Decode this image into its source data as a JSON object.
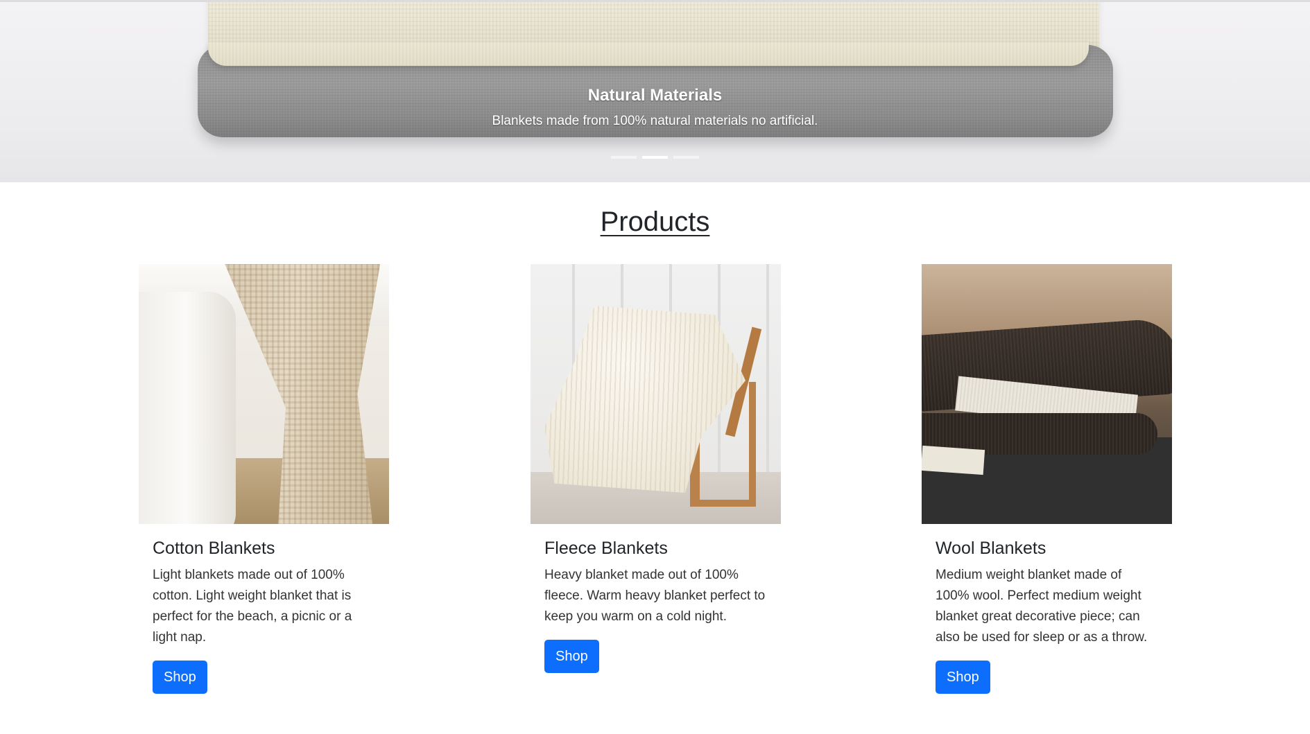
{
  "carousel": {
    "caption_title": "Natural Materials",
    "caption_text": "Blankets made from 100% natural materials no artificial.",
    "slide_count": 3,
    "active_index": 1
  },
  "products": {
    "title": "Products",
    "items": [
      {
        "name": "Cotton Blankets",
        "description": "Light blankets made out of 100% cotton. Light weight blanket that is perfect for the beach, a picnic or a light nap.",
        "button_label": "Shop"
      },
      {
        "name": "Fleece Blankets",
        "description": "Heavy blanket made out of 100% fleece. Warm heavy blanket perfect to keep you warm on a cold night.",
        "button_label": "Shop"
      },
      {
        "name": "Wool Blankets",
        "description": "Medium weight blanket made of 100% wool. Perfect medium weight blanket great decorative piece; can also be used for sleep or as a throw.",
        "button_label": "Shop"
      }
    ]
  },
  "colors": {
    "button": "#0d6efd",
    "text": "#212529"
  }
}
